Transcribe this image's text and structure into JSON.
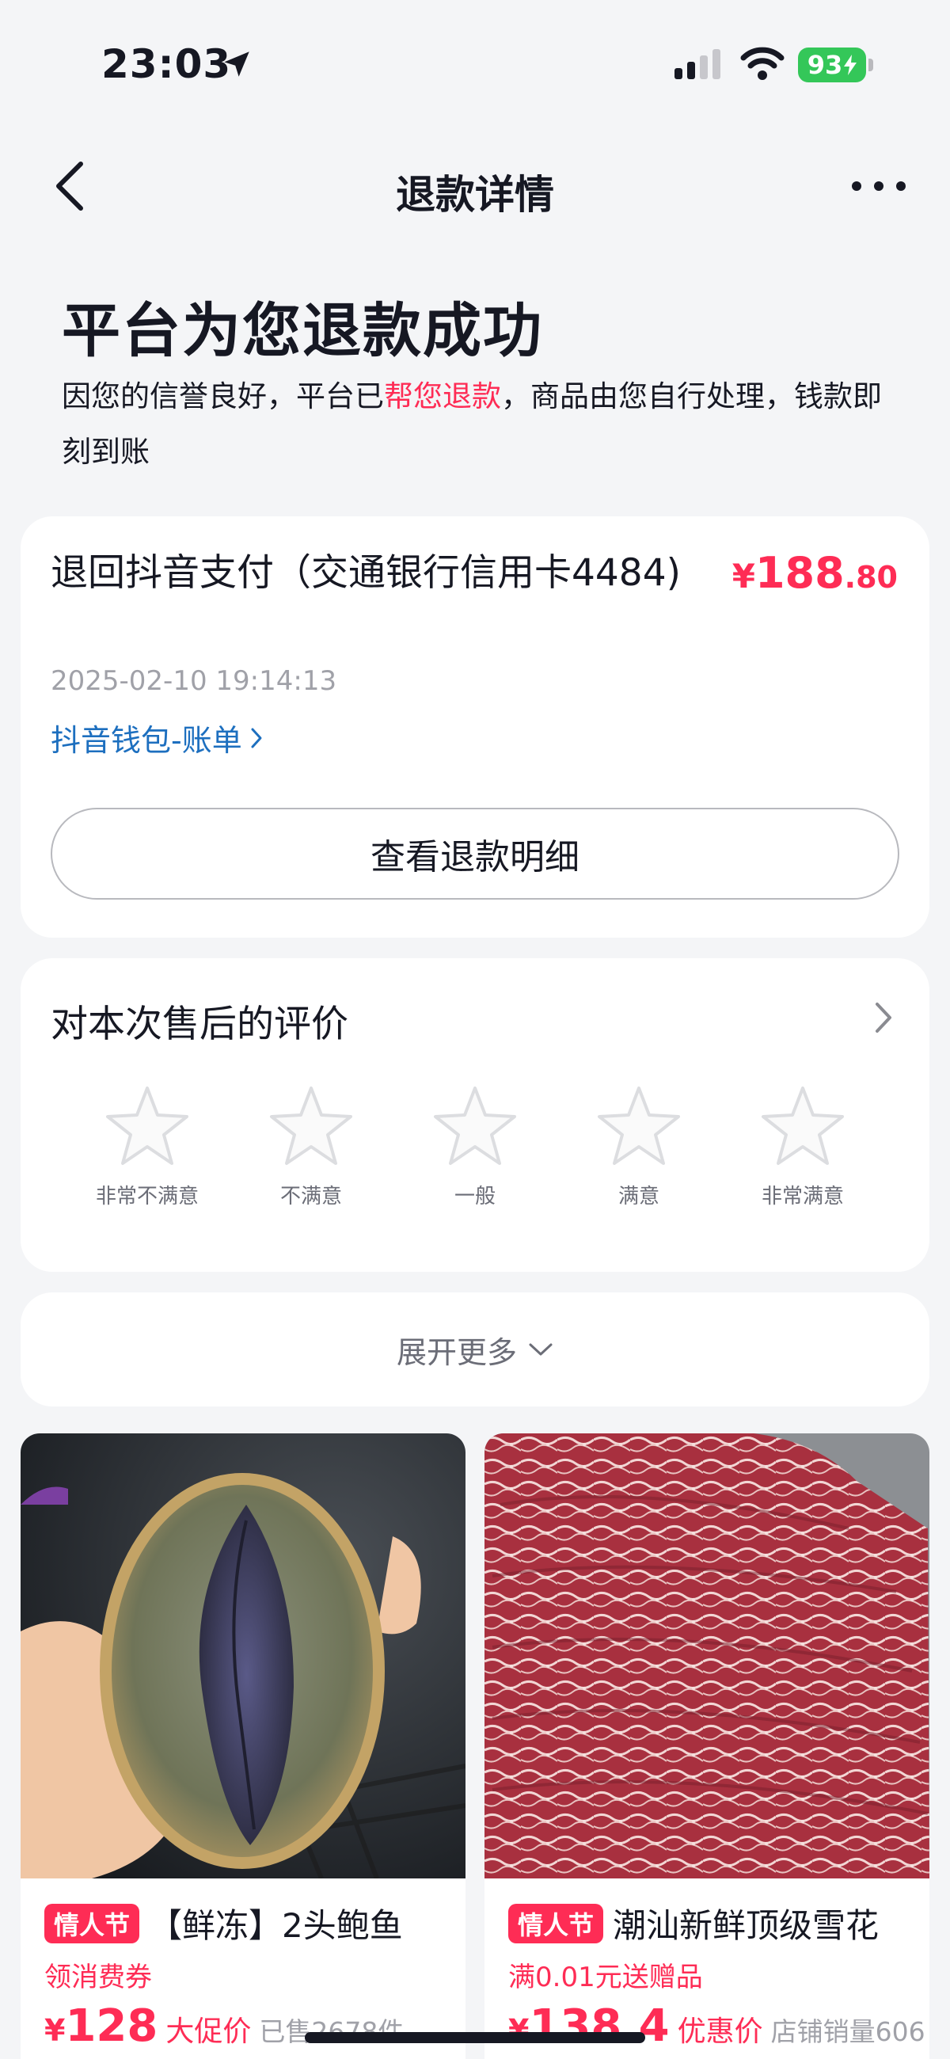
{
  "status_bar": {
    "time": "23:03",
    "battery": "93"
  },
  "nav": {
    "title": "退款详情"
  },
  "hero": {
    "title": "平台为您退款成功",
    "desc_before": "因您的信誉良好，平台已",
    "desc_highlight": "帮您退款",
    "desc_after": "，商品由您自行处理，钱款即刻到账"
  },
  "refund": {
    "method": "退回抖音支付（交通银行信用卡4484)",
    "currency": "¥",
    "amount_int": "188",
    "amount_dec": ".80",
    "time": "2025-02-10 19:14:13",
    "wallet_link": "抖音钱包-账单",
    "detail_button": "查看退款明细"
  },
  "rating": {
    "title": "对本次售后的评价",
    "options": [
      "非常不满意",
      "不满意",
      "一般",
      "满意",
      "非常满意"
    ]
  },
  "expand": {
    "label": "展开更多"
  },
  "products": [
    {
      "tag": "情人节",
      "title": "【鲜冻】2头鲍鱼",
      "promo": "领消费券",
      "currency": "¥",
      "price": "128",
      "price_tag": "大促价",
      "sold": "已售2678件"
    },
    {
      "tag": "情人节",
      "title": "潮汕新鲜顶级雪花",
      "promo": "满0.01元送赠品",
      "currency": "¥",
      "price": "138.4",
      "price_tag": "优惠价",
      "sold": "店铺销量606"
    }
  ],
  "colors": {
    "accent": "#fe2c55",
    "link": "#1d6fbf",
    "background": "#f4f5f7"
  }
}
